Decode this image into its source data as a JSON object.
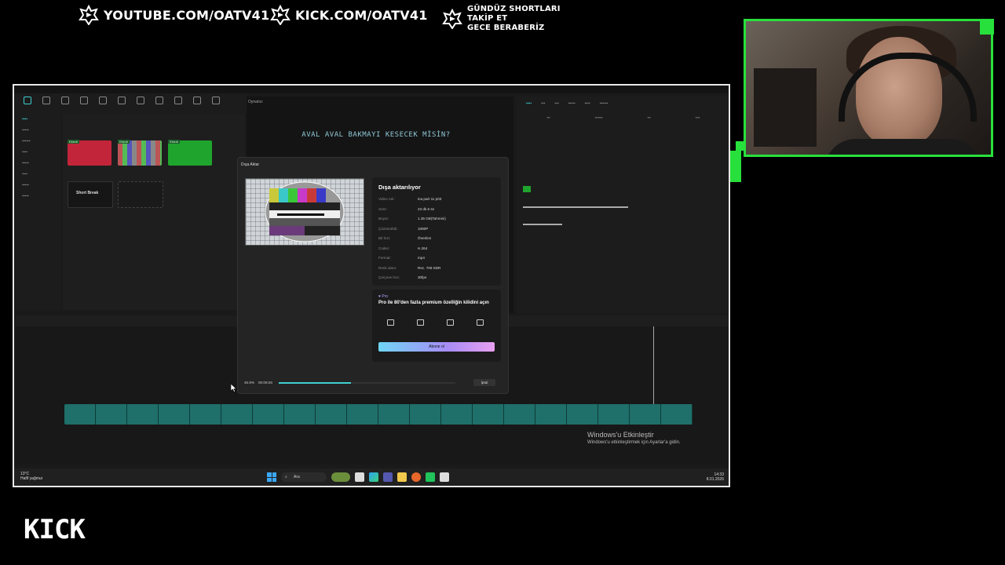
{
  "banner": {
    "youtube": "YOUTUBE.COM/OATV41",
    "kick": "KICK.COM/OATV41",
    "promo_line1": "GÜNDÜZ SHORTLARI",
    "promo_line2": "TAKİP ET",
    "promo_line3": "GECE BERABERİZ"
  },
  "player": {
    "header": "Oynatıcı",
    "overlay_text": "AVAL AVAL BAKMAYI KESECEK MİSİN?"
  },
  "media": {
    "thumb_labels": [
      "Ekledi",
      "Ekledi",
      "Ekledi"
    ],
    "short_break_label": "Short Break"
  },
  "export_dialog": {
    "title": "Dışa Aktar",
    "status_title": "Dışa aktarılıyor",
    "rows": [
      {
        "key": "Video Adı:",
        "value": "ina part 11 p03"
      },
      {
        "key": "Süre:",
        "value": "23 dk 6 sn"
      },
      {
        "key": "Boyut:",
        "value": "1.35 GB(Tahmini)"
      },
      {
        "key": "Çözünürlük:",
        "value": "1080P"
      },
      {
        "key": "Bit hızı:",
        "value": "Önerilen"
      },
      {
        "key": "Codec:",
        "value": "H.264"
      },
      {
        "key": "Format:",
        "value": "mp4"
      },
      {
        "key": "Renk alanı:",
        "value": "Rec. 709 SDR"
      },
      {
        "key": "Çerçeve hızı:",
        "value": "30fps"
      }
    ],
    "pro": {
      "tag": "Pro",
      "text": "Pro ile 80'den fazla premium özelliğin kilidini açın",
      "subscribe_label": "Abone ol"
    },
    "progress": {
      "percent_text": "45.8%",
      "elapsed": "00:09:26",
      "fraction": 0.41,
      "cancel_label": "İptal"
    }
  },
  "windows": {
    "activation_title": "Windows'u Etkinleştir",
    "activation_sub": "Windows'u etkinleştirmek için Ayarlar'a gidin.",
    "weather_temp": "13°C",
    "weather_desc": "Hafif yağmur",
    "search_label": "Ara",
    "clock_time": "14:33",
    "clock_date": "8.01.2026"
  },
  "kick_logo": "KICK",
  "colors": {
    "cam_border": "#28e03b",
    "accent": "#3fd0d0",
    "timeline_clip": "#1f6f6a"
  }
}
